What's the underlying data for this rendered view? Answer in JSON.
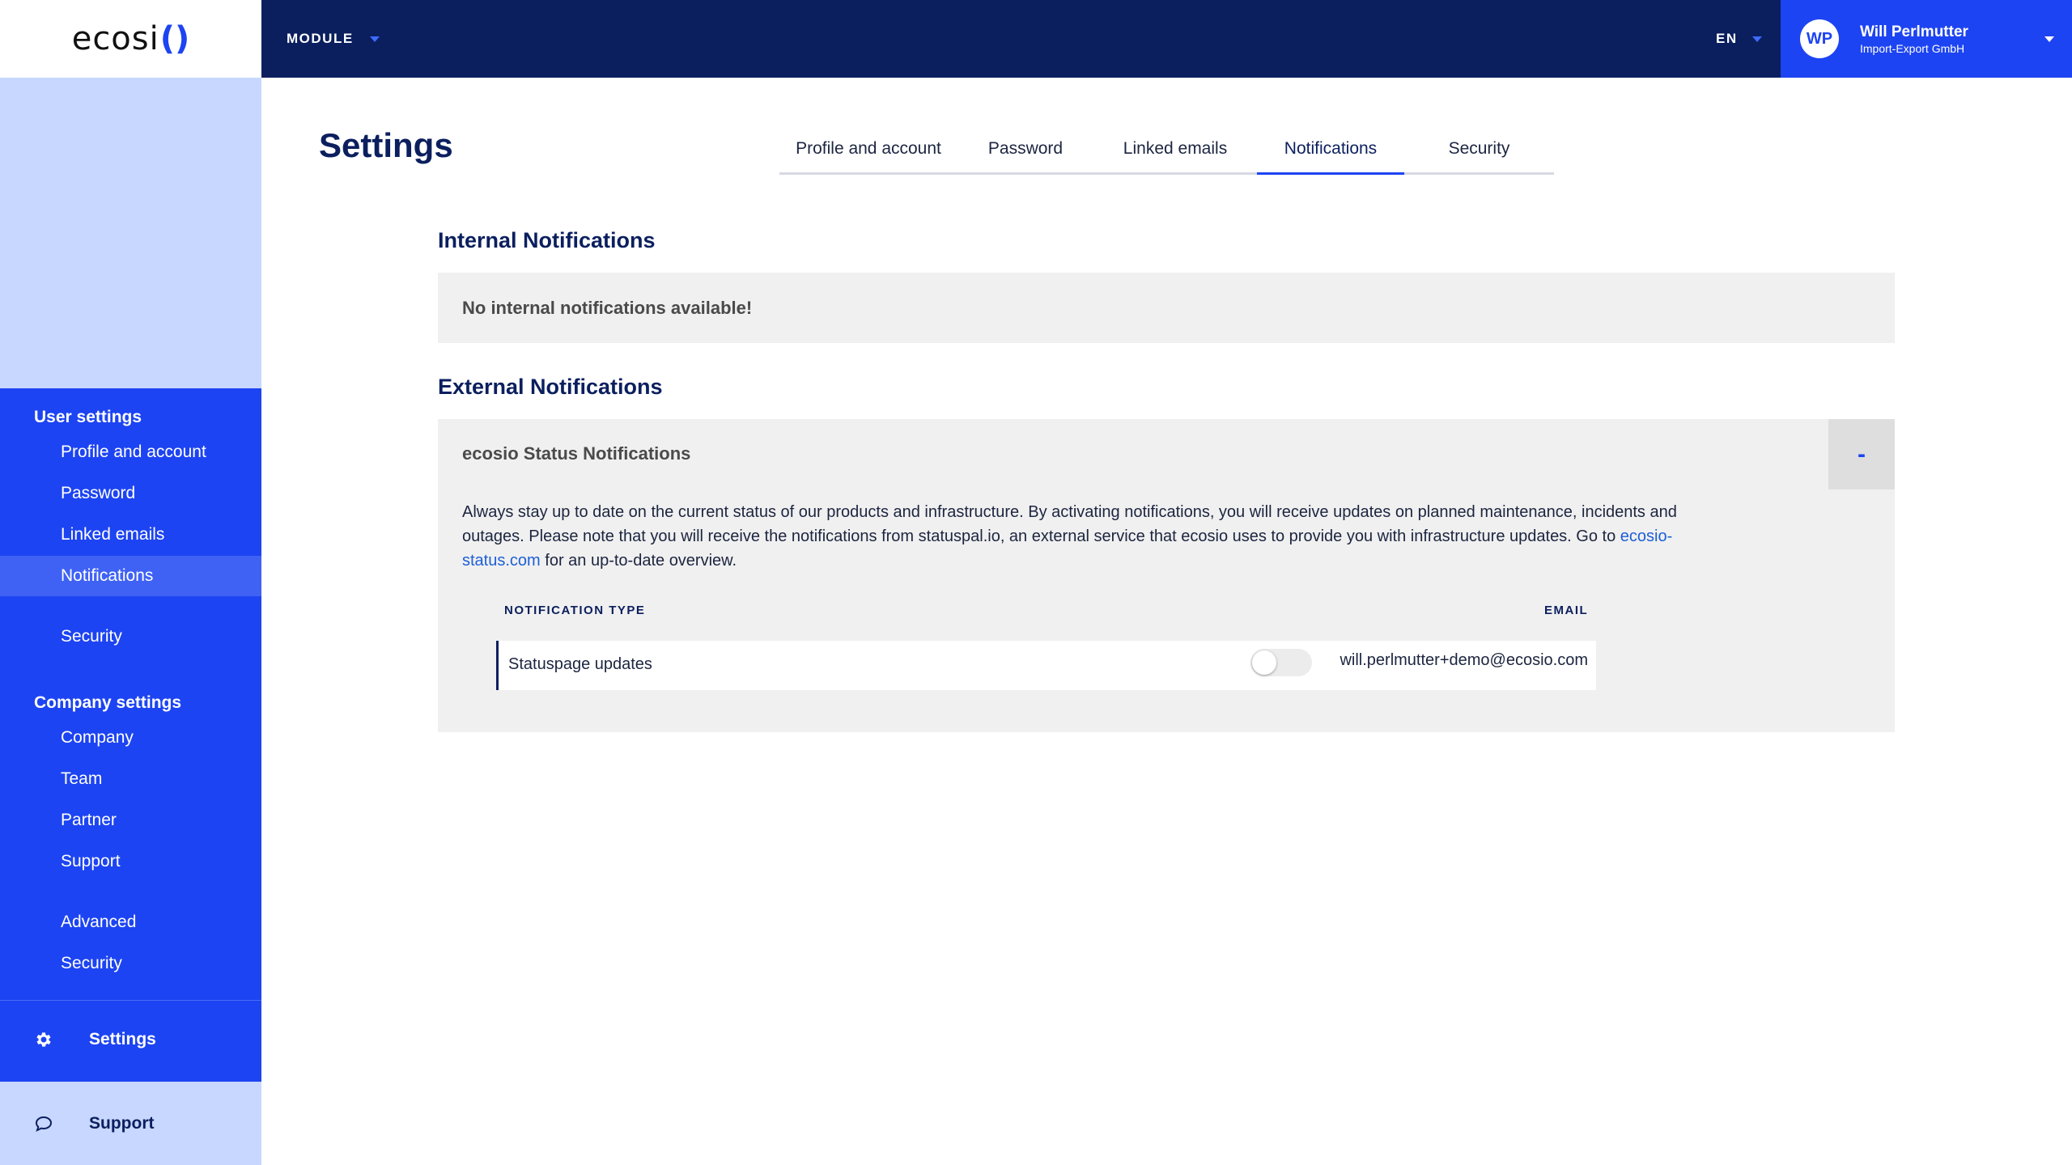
{
  "app": {
    "logo_text": "ecosi",
    "logo_mark": "()",
    "module_label": "MODULE",
    "language": "EN",
    "user": {
      "initials": "WP",
      "name": "Will Perlmutter",
      "company": "Import-Export GmbH"
    }
  },
  "sidebar": {
    "user_settings_heading": "User settings",
    "user_items": [
      {
        "label": "Profile and account"
      },
      {
        "label": "Password"
      },
      {
        "label": "Linked emails"
      },
      {
        "label": "Notifications",
        "active": true
      },
      {
        "label": "Security"
      }
    ],
    "company_settings_heading": "Company settings",
    "company_items": [
      {
        "label": "Company"
      },
      {
        "label": "Team"
      },
      {
        "label": "Partner"
      },
      {
        "label": "Support"
      },
      {
        "label": "Advanced"
      },
      {
        "label": "Security"
      }
    ],
    "settings_label": "Settings",
    "support_label": "Support"
  },
  "page": {
    "title": "Settings",
    "tabs": [
      {
        "label": "Profile and account"
      },
      {
        "label": "Password"
      },
      {
        "label": "Linked emails"
      },
      {
        "label": "Notifications",
        "active": true
      },
      {
        "label": "Security"
      }
    ]
  },
  "internal": {
    "title": "Internal Notifications",
    "empty_message": "No internal notifications available!"
  },
  "external": {
    "title": "External Notifications",
    "panel_title": "ecosio Status Notifications",
    "collapse_label": "-",
    "description_before": "Always stay up to date on the current status of our products and infrastructure. By activating notifications, you will receive updates on planned maintenance, incidents and outages. Please note that you will receive the notifications from statuspal.io, an external service that ecosio uses to provide you with infrastructure updates. Go to ",
    "description_link": "ecosio-status.com",
    "description_after": " for an up-to-date overview.",
    "table": {
      "col_type": "NOTIFICATION TYPE",
      "col_email": "EMAIL",
      "rows": [
        {
          "type": "Statuspage updates",
          "enabled": false,
          "email": "will.perlmutter+demo@ecosio.com"
        }
      ]
    }
  },
  "colors": {
    "navy": "#0b1f5e",
    "brand_blue": "#1d44f2",
    "sidebar_light": "#c7d7ff",
    "panel_gray": "#f0f0f0",
    "link": "#1d5fd6"
  }
}
